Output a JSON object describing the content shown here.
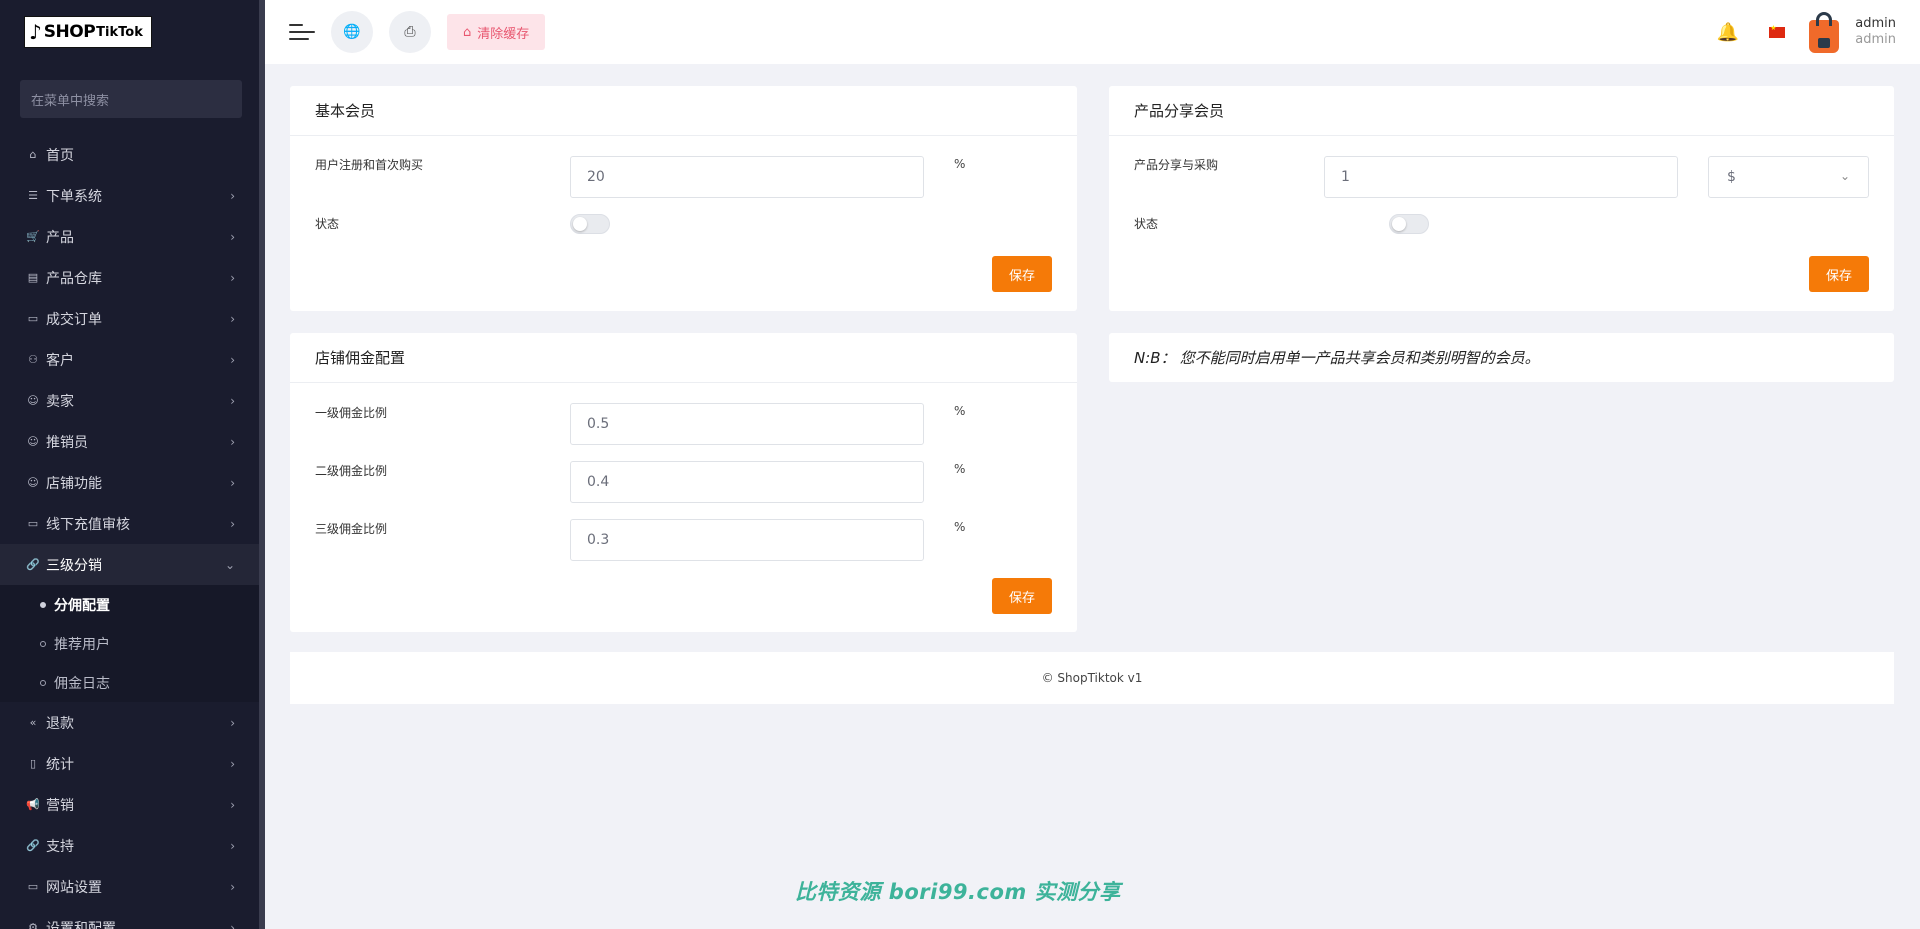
{
  "logo": {
    "glyph": "♪",
    "shop": "SHOP",
    "tiktok": "TikTok"
  },
  "sidebar": {
    "search_placeholder": "在菜单中搜索",
    "items": [
      {
        "label": "首页",
        "icon": "⌂",
        "chevron": ""
      },
      {
        "label": "下单系统",
        "icon": "☰",
        "chevron": "›"
      },
      {
        "label": "产品",
        "icon": "🛒",
        "chevron": "›"
      },
      {
        "label": "产品仓库",
        "icon": "▤",
        "chevron": "›"
      },
      {
        "label": "成交订单",
        "icon": "▭",
        "chevron": "›"
      },
      {
        "label": "客户",
        "icon": "⚇",
        "chevron": "›"
      },
      {
        "label": "卖家",
        "icon": "☺",
        "chevron": "›"
      },
      {
        "label": "推销员",
        "icon": "☺",
        "chevron": "›"
      },
      {
        "label": "店铺功能",
        "icon": "☺",
        "chevron": "›"
      },
      {
        "label": "线下充值审核",
        "icon": "▭",
        "chevron": "›"
      },
      {
        "label": "三级分销",
        "icon": "🔗",
        "chevron": "⌄"
      }
    ],
    "subitems": [
      {
        "label": "分佣配置"
      },
      {
        "label": "推荐用户"
      },
      {
        "label": "佣金日志"
      }
    ],
    "items_after": [
      {
        "label": "退款",
        "icon": "«",
        "chevron": "›"
      },
      {
        "label": "统计",
        "icon": "▯",
        "chevron": "›"
      },
      {
        "label": "营销",
        "icon": "📢",
        "chevron": "›"
      },
      {
        "label": "支持",
        "icon": "🔗",
        "chevron": "›"
      },
      {
        "label": "网站设置",
        "icon": "▭",
        "chevron": "›"
      },
      {
        "label": "设置和配置",
        "icon": "⚙",
        "chevron": "›"
      }
    ]
  },
  "header": {
    "globe_icon": "🌐",
    "print_icon": "⎙",
    "clear_cache_label": "清除缓存",
    "clear_cache_icon": "⌂",
    "bell_icon": "🔔",
    "user_name": "admin",
    "user_role": "admin"
  },
  "basic_member": {
    "title": "基本会员",
    "field_label": "用户注册和首次购买",
    "field_value": "20",
    "unit": "%",
    "status_label": "状态",
    "status_on": false,
    "save_label": "保存"
  },
  "product_share": {
    "title": "产品分享会员",
    "field_label": "产品分享与采购",
    "field_value": "1",
    "select_value": "$",
    "select_caret": "⌄",
    "status_label": "状态",
    "status_on": false,
    "save_label": "保存"
  },
  "commission": {
    "title": "店铺佣金配置",
    "levels": [
      {
        "label": "一级佣金比例",
        "value": "0.5",
        "unit": "%"
      },
      {
        "label": "二级佣金比例",
        "value": "0.4",
        "unit": "%"
      },
      {
        "label": "三级佣金比例",
        "value": "0.3",
        "unit": "%"
      }
    ],
    "save_label": "保存"
  },
  "note": {
    "prefix": "N:B：",
    "text": "您不能同时启用单一产品共享会员和类别明智的会员。"
  },
  "footer": {
    "text": "© ShopTiktok v1"
  },
  "watermark": "比特资源 bori99.com 实测分享",
  "colors": {
    "sidebar_bg": "#1a1c2e",
    "accent": "#f57a08",
    "clear_cache_bg": "#fde4e9",
    "clear_cache_fg": "#e8566f"
  }
}
